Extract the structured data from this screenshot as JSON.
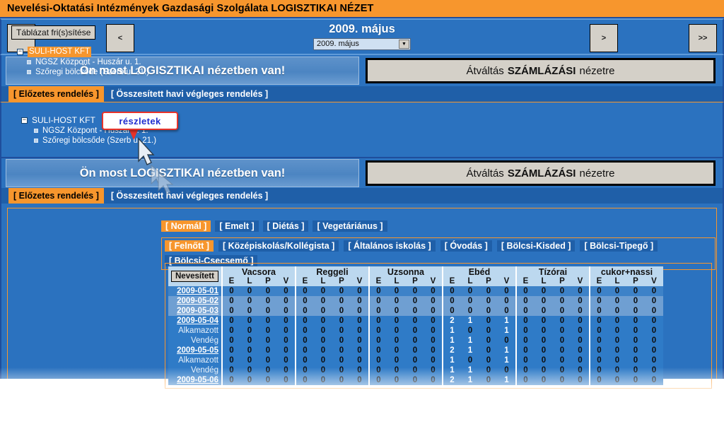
{
  "window": {
    "title": "Nevelési-Oktatási Intézmények Gazdasági Szolgálata LOGISZTIKAI NÉZET"
  },
  "nav": {
    "first_label": "<<",
    "prev_label": "<",
    "next_label": ">",
    "last_label": ">>",
    "month_heading": "2009. május",
    "month_select_value": "2009. május",
    "select_arrow": "▼"
  },
  "banner": {
    "note": "Ön most LOGISZTIKAI nézetben van!",
    "switch_prefix": "Átváltás",
    "switch_strong": "SZÁMLÁZÁSI",
    "switch_suffix": "nézetre"
  },
  "order_tabs": [
    {
      "label": "[ Előzetes rendelés ]",
      "active": true
    },
    {
      "label": "[ Összesített havi végleges rendelés ]",
      "active": false
    }
  ],
  "tooltip": {
    "text": "részletek"
  },
  "tree_upper": {
    "expander": "−",
    "root": "SULI-HOST KFT",
    "children": [
      "NGSZ Központ - Huszár u. 1.",
      "Szőregi bölcsőde (Szerb u. 21.)"
    ]
  },
  "sidebar": {
    "refresh_label": "Táblázat fri(s)sítése",
    "expander": "−",
    "root": "SULI-HOST KFT",
    "children": [
      "NGSZ Központ - Huszár u. 1.",
      "Szőregi bölcsőde (Szerb u. 21.)"
    ]
  },
  "category_tabs": [
    {
      "label": "[ Normál ]",
      "active": true
    },
    {
      "label": "[ Emelt ]",
      "active": false
    },
    {
      "label": "[ Diétás ]",
      "active": false
    },
    {
      "label": "[ Vegetáriánus ]",
      "active": false
    }
  ],
  "age_tabs": [
    {
      "label": "[ Felnőtt ]",
      "active": true
    },
    {
      "label": "[ Középiskolás/Kollégista ]",
      "active": false
    },
    {
      "label": "[ Általános iskolás ]",
      "active": false
    },
    {
      "label": "[ Óvodás ]",
      "active": false
    },
    {
      "label": "[ Bölcsi-Kisded ]",
      "active": false
    },
    {
      "label": "[ Bölcsi-Tipegő ]",
      "active": false
    },
    {
      "label": "[ Bölcsi-Csecsemő ]",
      "active": false
    }
  ],
  "table": {
    "named_button": "Nevesített",
    "meal_groups": [
      "Vacsora",
      "Reggeli",
      "Uzsonna",
      "Ebéd",
      "Tízórai",
      "cukor+nassi"
    ],
    "sub_columns": [
      "E",
      "L",
      "P",
      "V"
    ],
    "rows": [
      {
        "label": "2009-05-01",
        "kind": "date",
        "shade": "zero",
        "values": [
          0,
          0,
          0,
          0,
          0,
          0,
          0,
          0,
          0,
          0,
          0,
          0,
          0,
          0,
          0,
          0,
          0,
          0,
          0,
          0,
          0,
          0,
          0,
          0
        ]
      },
      {
        "label": "2009-05-02",
        "kind": "date",
        "shade": "zero-alt",
        "values": [
          0,
          0,
          0,
          0,
          0,
          0,
          0,
          0,
          0,
          0,
          0,
          0,
          0,
          0,
          0,
          0,
          0,
          0,
          0,
          0,
          0,
          0,
          0,
          0
        ]
      },
      {
        "label": "2009-05-03",
        "kind": "date",
        "shade": "zero-alt",
        "values": [
          0,
          0,
          0,
          0,
          0,
          0,
          0,
          0,
          0,
          0,
          0,
          0,
          0,
          0,
          0,
          0,
          0,
          0,
          0,
          0,
          0,
          0,
          0,
          0
        ]
      },
      {
        "label": "2009-05-04",
        "kind": "date",
        "shade": "data",
        "values": [
          0,
          0,
          0,
          0,
          0,
          0,
          0,
          0,
          0,
          0,
          0,
          0,
          2,
          1,
          0,
          1,
          0,
          0,
          0,
          0,
          0,
          0,
          0,
          0
        ]
      },
      {
        "label": "Alkamazott",
        "kind": "sub",
        "shade": "data",
        "values": [
          0,
          0,
          0,
          0,
          0,
          0,
          0,
          0,
          0,
          0,
          0,
          0,
          1,
          0,
          0,
          1,
          0,
          0,
          0,
          0,
          0,
          0,
          0,
          0
        ]
      },
      {
        "label": "Vendég",
        "kind": "sub",
        "shade": "data",
        "values": [
          0,
          0,
          0,
          0,
          0,
          0,
          0,
          0,
          0,
          0,
          0,
          0,
          1,
          1,
          0,
          0,
          0,
          0,
          0,
          0,
          0,
          0,
          0,
          0
        ]
      },
      {
        "label": "2009-05-05",
        "kind": "date",
        "shade": "data",
        "values": [
          0,
          0,
          0,
          0,
          0,
          0,
          0,
          0,
          0,
          0,
          0,
          0,
          2,
          1,
          0,
          1,
          0,
          0,
          0,
          0,
          0,
          0,
          0,
          0
        ]
      },
      {
        "label": "Alkamazott",
        "kind": "sub",
        "shade": "data",
        "values": [
          0,
          0,
          0,
          0,
          0,
          0,
          0,
          0,
          0,
          0,
          0,
          0,
          1,
          0,
          0,
          1,
          0,
          0,
          0,
          0,
          0,
          0,
          0,
          0
        ]
      },
      {
        "label": "Vendég",
        "kind": "sub",
        "shade": "data",
        "values": [
          0,
          0,
          0,
          0,
          0,
          0,
          0,
          0,
          0,
          0,
          0,
          0,
          1,
          1,
          0,
          0,
          0,
          0,
          0,
          0,
          0,
          0,
          0,
          0
        ]
      },
      {
        "label": "2009-05-06",
        "kind": "date",
        "shade": "data",
        "values": [
          0,
          0,
          0,
          0,
          0,
          0,
          0,
          0,
          0,
          0,
          0,
          0,
          2,
          1,
          0,
          1,
          0,
          0,
          0,
          0,
          0,
          0,
          0,
          0
        ]
      }
    ]
  },
  "colors": {
    "title_orange": "#f7962d",
    "blue_frame": "#1f4e9c",
    "panel_blue": "#2b72bf",
    "tab_blue": "#1f5fa8",
    "header_light": "#bcd8ef",
    "tooltip_border": "#e8332a",
    "tooltip_text": "#1f2dd0"
  }
}
